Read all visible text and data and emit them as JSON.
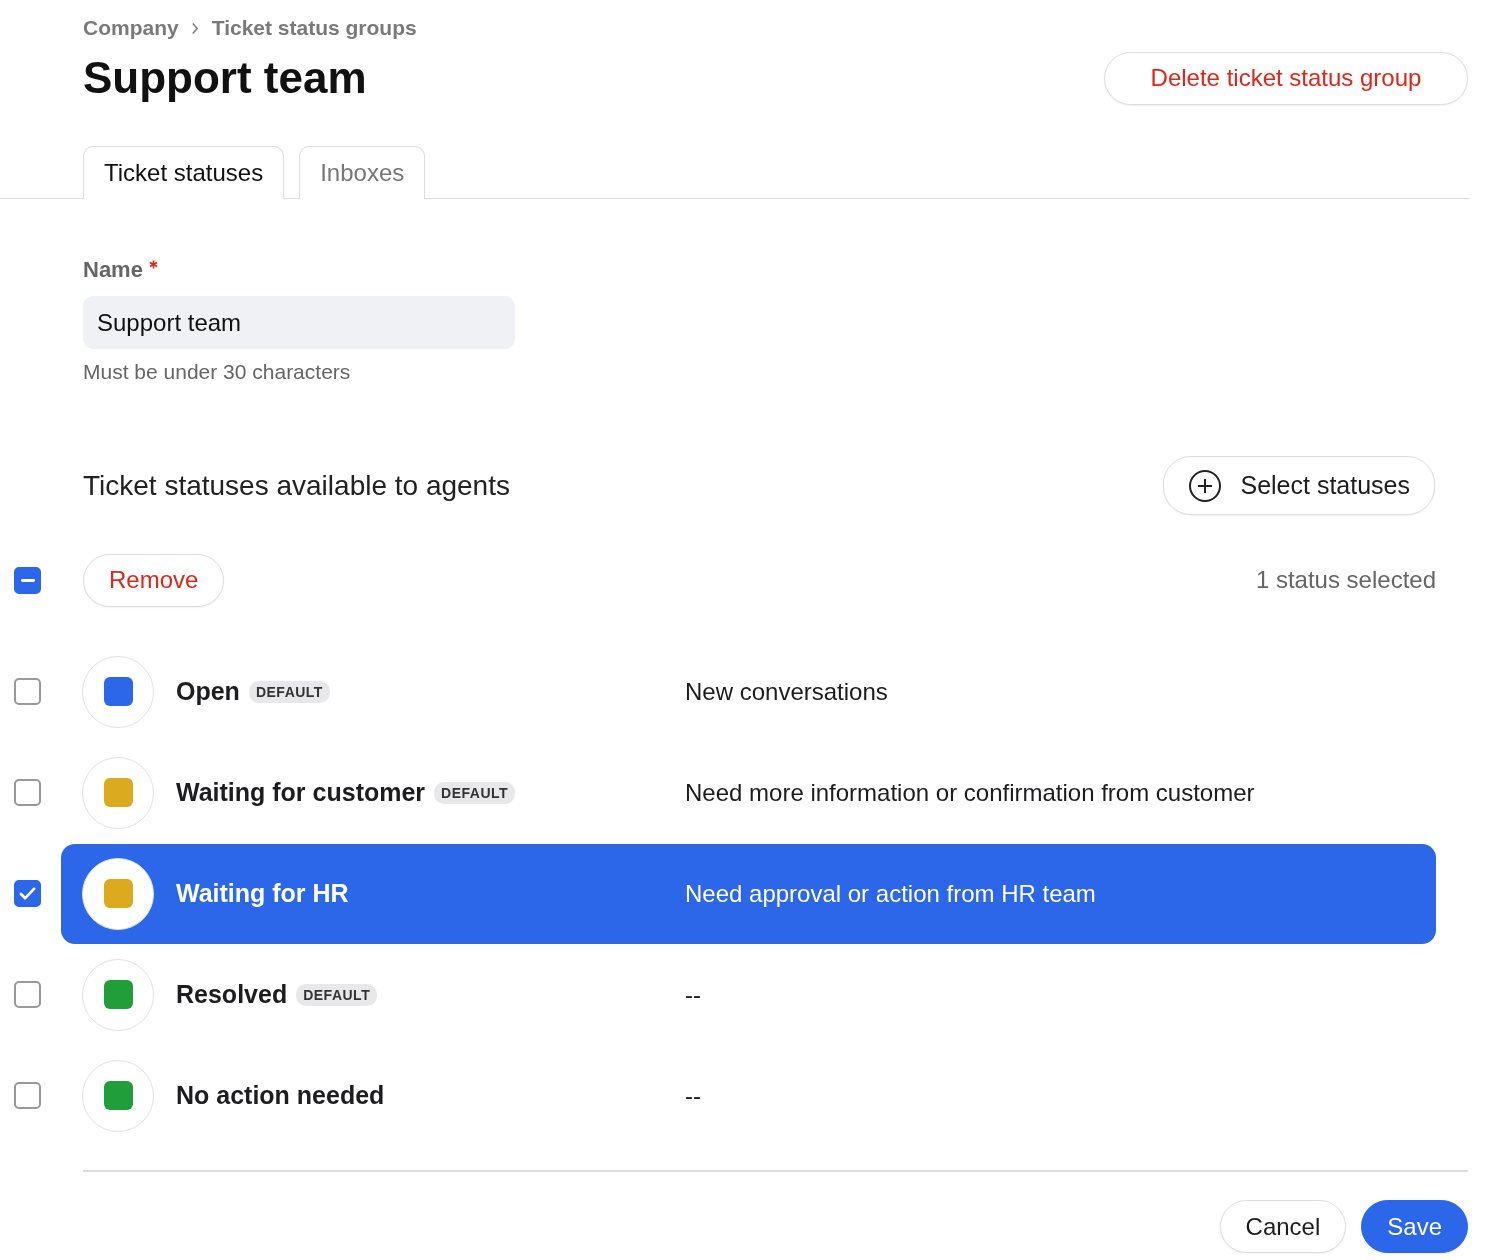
{
  "breadcrumb": [
    "Company",
    "Ticket status groups"
  ],
  "title": "Support team",
  "delete_button": "Delete ticket status group",
  "tabs": [
    {
      "label": "Ticket statuses",
      "selected": true
    },
    {
      "label": "Inboxes",
      "selected": false
    }
  ],
  "name_field": {
    "label": "Name",
    "required": true,
    "value": "Support team",
    "hint": "Must be under 30 characters"
  },
  "section_title": "Ticket statuses available to agents",
  "select_button": "Select statuses",
  "bulk": {
    "select_all_indeterminate": true,
    "remove_button": "Remove",
    "count": "1 status selected"
  },
  "statuses": [
    {
      "name": "Open",
      "badge": "DEFAULT",
      "description": "New conversations",
      "color": "#2b67e8",
      "selected": false
    },
    {
      "name": "Waiting for customer",
      "badge": "DEFAULT",
      "description": "Need more information or confirmation from customer",
      "color": "#dcaa1f",
      "selected": false
    },
    {
      "name": "Waiting for HR",
      "description": "Need approval or action from HR team",
      "color": "#dcaa1f",
      "selected": true
    },
    {
      "name": "Resolved",
      "badge": "DEFAULT",
      "description": "--",
      "color": "#1f9e3a",
      "selected": false
    },
    {
      "name": "No action needed",
      "description": "--",
      "color": "#1f9e3a",
      "selected": false
    }
  ],
  "footer": {
    "cancel": "Cancel",
    "save": "Save"
  }
}
